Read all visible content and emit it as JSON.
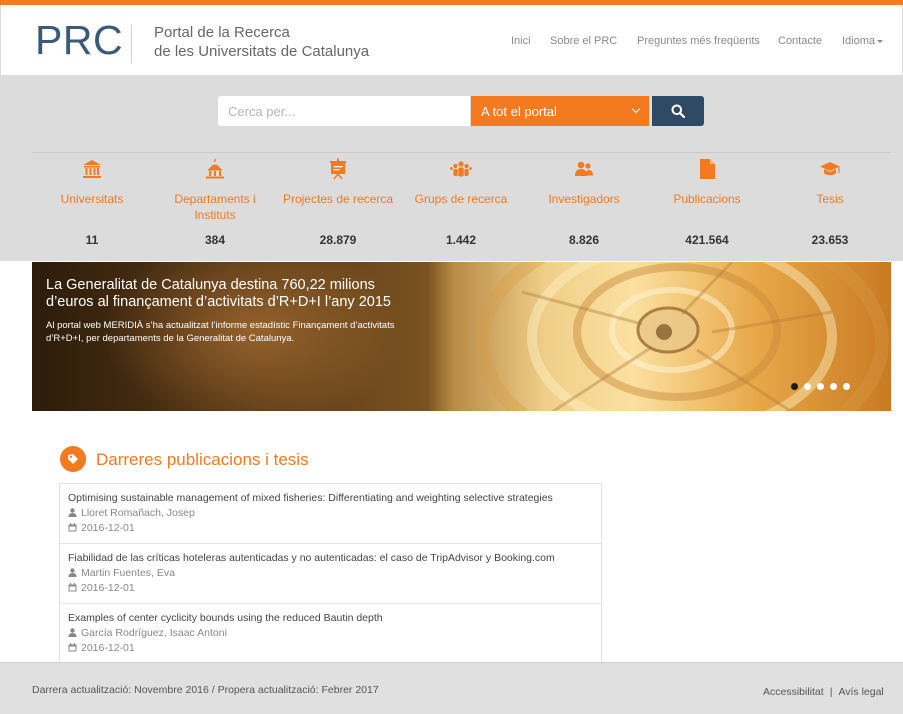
{
  "header": {
    "logo": "PRC",
    "tagline_line1": "Portal de la Recerca",
    "tagline_line2": "de les Universitats de Catalunya"
  },
  "nav": {
    "items": [
      {
        "label": "Inici"
      },
      {
        "label": "Sobre el PRC"
      },
      {
        "label": "Preguntes més freqüents"
      },
      {
        "label": "Contacte"
      },
      {
        "label": "Idioma"
      }
    ]
  },
  "search": {
    "placeholder": "Cerca per...",
    "scope": "A tot el portal"
  },
  "stats": [
    {
      "icon": "university-icon",
      "label": "Universitats",
      "count": "11"
    },
    {
      "icon": "building-icon",
      "label": "Departaments i Instituts",
      "count": "384"
    },
    {
      "icon": "presentation-icon",
      "label": "Projectes de recerca",
      "count": "28.879"
    },
    {
      "icon": "group-icon",
      "label": "Grups de recerca",
      "count": "1.442"
    },
    {
      "icon": "users-icon",
      "label": "Investigadors",
      "count": "8.826"
    },
    {
      "icon": "document-icon",
      "label": "Publicacions",
      "count": "421.564"
    },
    {
      "icon": "graduation-cap-icon",
      "label": "Tesis",
      "count": "23.653"
    }
  ],
  "hero": {
    "title": "La Generalitat de Catalunya destina 760,22 milions d’euros al finançament d’activitats d’R+D+I l’any 2015",
    "text": "Al portal web MERIDIÀ s’ha actualitzat l’informe estadístic Finançament d’activitats d’R+D+I, per departaments de la Generalitat de Catalunya."
  },
  "publications": {
    "section_title": "Darreres publicacions i tesis",
    "items": [
      {
        "title": "Optimising sustainable management of mixed fisheries: Differentiating and weighting selective strategies",
        "author": "Lloret Romañach, Josep",
        "date": "2016-12-01"
      },
      {
        "title": "Fiabilidad de las críticas hoteleras autenticadas y no autenticadas: el caso de TripAdvisor y Booking.com",
        "author": "Martin Fuentes, Eva",
        "date": "2016-12-01"
      },
      {
        "title": "Examples of center cyclicity bounds using the reduced Bautin depth",
        "author": "García Rodríguez, Isaac Antoni",
        "date": "2016-12-01"
      }
    ]
  },
  "footer": {
    "update_text": "Darrera actualització: Novembre 2016 / Propera actualització: Febrer 2017",
    "accessibility": "Accessibilitat",
    "separator": "|",
    "legal": "Avís legal"
  },
  "colors": {
    "accent": "#f47a20",
    "navy": "#2e4a64",
    "logo": "#3b5a7a",
    "band": "#dcdcdc"
  }
}
